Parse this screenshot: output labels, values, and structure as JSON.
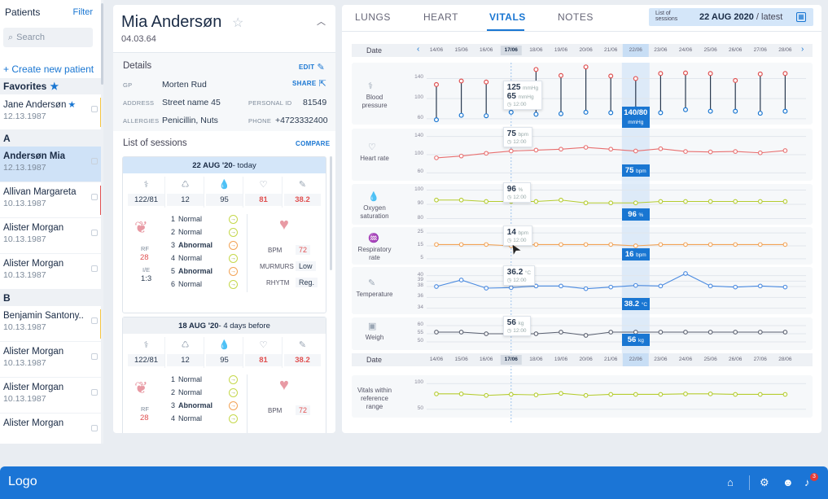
{
  "sidebar": {
    "title": "Patients",
    "filter": "Filter",
    "search_placeholder": "Search",
    "create": "+ Create new patient",
    "favorites_label": "Favorites",
    "sections": [
      {
        "letter": "A"
      },
      {
        "letter": "B"
      }
    ],
    "favorites": [
      {
        "name": "Jane Andersøn",
        "date": "12.13.1987",
        "starred": true,
        "bar": "#f5c542"
      }
    ],
    "group_a": [
      {
        "name": "Andersøn Mia",
        "date": "12.13.1987",
        "selected": true
      },
      {
        "name": "Allivan Margareta",
        "date": "10.13.1987",
        "bar": "#e05050"
      },
      {
        "name": "Alister Morgan",
        "date": "10.13.1987"
      },
      {
        "name": "Alister Morgan",
        "date": "10.13.1987"
      }
    ],
    "group_b": [
      {
        "name": "Benjamin Santony..",
        "date": "10.13.1987",
        "bar": "#f5c542"
      },
      {
        "name": "Alister Morgan",
        "date": "10.13.1987"
      },
      {
        "name": "Alister Morgan",
        "date": "10.13.1987"
      },
      {
        "name": "Alister Morgan",
        "date": ""
      }
    ]
  },
  "patient": {
    "name": "Mia Andersøn",
    "dob": "04.03.64",
    "details_title": "Details",
    "edit": "EDIT",
    "share": "SHARE",
    "gp_k": "GP",
    "gp_v": "Morten Rud",
    "address_k": "ADDRESS",
    "address_v": "Street name 45",
    "pid_k": "PERSONAL ID",
    "pid_v": "81549",
    "allergies_k": "ALLERGIES",
    "allergies_v": "Penicillin, Nuts",
    "phone_k": "PHONE",
    "phone_v": "+4723332400"
  },
  "sessions": {
    "title": "List of sessions",
    "compare": "COMPARE",
    "items": [
      {
        "head_date": "22 AUG '20",
        "head_rel": " - today",
        "vitals": [
          "122/81",
          "12",
          "95",
          "81",
          "38.2"
        ],
        "vitals_red": [
          false,
          false,
          false,
          true,
          true
        ],
        "rf_k": "RF",
        "rf_v": "28",
        "ie_k": "I/E",
        "ie_v": "1:3",
        "lung_rows": [
          {
            "n": "1",
            "t": "Normal",
            "ab": false
          },
          {
            "n": "2",
            "t": "Normal",
            "ab": false
          },
          {
            "n": "3",
            "t": "Abnormal",
            "ab": true
          },
          {
            "n": "4",
            "t": "Normal",
            "ab": false
          },
          {
            "n": "5",
            "t": "Abnormal",
            "ab": true
          },
          {
            "n": "6",
            "t": "Normal",
            "ab": false
          }
        ],
        "bpm_k": "BPM",
        "bpm_v": "72",
        "murmurs_k": "MURMURS",
        "murmurs_v": "Low",
        "rhythm_k": "RHYTM",
        "rhythm_v": "Reg."
      },
      {
        "head_date": "18 AUG '20",
        "head_rel": " - 4 days before",
        "vitals": [
          "122/81",
          "12",
          "95",
          "81",
          "38.2"
        ],
        "vitals_red": [
          false,
          false,
          false,
          true,
          true
        ],
        "rf_k": "RF",
        "rf_v": "28",
        "lung_rows": [
          {
            "n": "1",
            "t": "Normal",
            "ab": false
          },
          {
            "n": "2",
            "t": "Normal",
            "ab": false
          },
          {
            "n": "3",
            "t": "Abnormal",
            "ab": true
          },
          {
            "n": "4",
            "t": "Normal",
            "ab": false
          }
        ],
        "bpm_k": "BPM",
        "bpm_v": "72"
      }
    ]
  },
  "tabs": [
    {
      "label": "LUNGS",
      "active": false
    },
    {
      "label": "HEART",
      "active": false
    },
    {
      "label": "VITALS",
      "active": true
    },
    {
      "label": "NOTES",
      "active": false
    }
  ],
  "session_picker": {
    "label": "List of sessions",
    "date": "22 AUG 2020",
    "suffix": " / latest"
  },
  "chart_data": {
    "type": "line",
    "dates": [
      "14/06",
      "15/06",
      "16/06",
      "17/06",
      "18/06",
      "19/06",
      "20/06",
      "21/06",
      "22/06",
      "23/06",
      "24/06",
      "25/06",
      "26/06",
      "27/06",
      "28/06"
    ],
    "date_label": "Date",
    "highlight_index": 3,
    "selected_index": 8,
    "rows": [
      {
        "label": "Blood pressure",
        "kind": "range",
        "ticks": [
          60,
          100,
          140
        ],
        "ylim": [
          55,
          165
        ],
        "systolic": [
          128,
          135,
          133,
          131,
          158,
          146,
          163,
          145,
          140,
          150,
          151,
          150,
          136,
          149,
          150
        ],
        "diastolic": [
          58,
          67,
          66,
          73,
          69,
          70,
          73,
          72,
          80,
          72,
          78,
          75,
          75,
          71,
          75
        ],
        "tooltip": {
          "a": "125",
          "au": "mmHg",
          "b": "65",
          "bu": "mmHg",
          "time": "12:00",
          "index": 3
        },
        "bubble": {
          "v": "140/80",
          "u": "mmHg"
        }
      },
      {
        "label": "Heart rate",
        "kind": "line",
        "color": "#e87070",
        "ticks": [
          60,
          100,
          140
        ],
        "ylim": [
          50,
          150
        ],
        "values": [
          93,
          97,
          103,
          108,
          110,
          112,
          116,
          112,
          108,
          113,
          107,
          106,
          107,
          104,
          109
        ],
        "tooltip": {
          "a": "75",
          "au": "bpm",
          "time": "12:00",
          "index": 3
        },
        "bubble": {
          "v": "75",
          "u": "bpm"
        }
      },
      {
        "label": "Oxygen saturation",
        "kind": "line",
        "color": "#b5cc30",
        "ticks": [
          80,
          90,
          100
        ],
        "ylim": [
          78,
          102
        ],
        "values": [
          93,
          93,
          92,
          92,
          92,
          93,
          91,
          91,
          91,
          92,
          92,
          92,
          92,
          92,
          92
        ],
        "tooltip": {
          "a": "96",
          "au": "%",
          "time": "12:00",
          "index": 3
        },
        "bubble": {
          "v": "96",
          "u": "%"
        }
      },
      {
        "label": "Respiratory rate",
        "kind": "line",
        "color": "#f2a356",
        "ticks": [
          5,
          15,
          25
        ],
        "ylim": [
          3,
          27
        ],
        "values": [
          16,
          16,
          16,
          15,
          16,
          16,
          16,
          16,
          15,
          16,
          16,
          16,
          16,
          16,
          16
        ],
        "tooltip": {
          "a": "14",
          "au": "bpm",
          "time": "12:00",
          "index": 3
        },
        "bubble": {
          "v": "16",
          "u": "bpm"
        }
      },
      {
        "label": "Temperature",
        "kind": "line",
        "color": "#4a8ae0",
        "ticks": [
          34,
          36,
          38,
          39,
          40
        ],
        "ylim": [
          33.5,
          41
        ],
        "values": [
          38,
          39.2,
          37.7,
          37.8,
          38.1,
          38.1,
          37.6,
          37.9,
          38.2,
          38.1,
          40.4,
          38.1,
          37.9,
          38.1,
          37.9
        ],
        "tooltip": {
          "a": "36.2",
          "au": "°C",
          "time": "12:00",
          "index": 3
        },
        "bubble": {
          "v": "38.2",
          "u": "°C"
        }
      },
      {
        "label": "Weigh",
        "kind": "line",
        "color": "#5a6070",
        "ticks": [
          50,
          55,
          60
        ],
        "ylim": [
          47,
          63
        ],
        "values": [
          56,
          56,
          55,
          55,
          55,
          56,
          54,
          56,
          56,
          56,
          56,
          56,
          56,
          56,
          56
        ],
        "tooltip": {
          "a": "56",
          "au": "kg",
          "time": "12:00",
          "index": 3
        },
        "bubble": {
          "v": "56",
          "u": "kg"
        }
      },
      {
        "label": "Vitals within reference range",
        "kind": "line",
        "color": "#b5cc30",
        "ticks": [
          50,
          100
        ],
        "ylim": [
          40,
          110
        ],
        "values": [
          80,
          80,
          77,
          79,
          78,
          81,
          77,
          79,
          79,
          79,
          80,
          80,
          79,
          79,
          79
        ]
      }
    ]
  },
  "footer": {
    "logo": "Logo",
    "notif_count": "3"
  }
}
